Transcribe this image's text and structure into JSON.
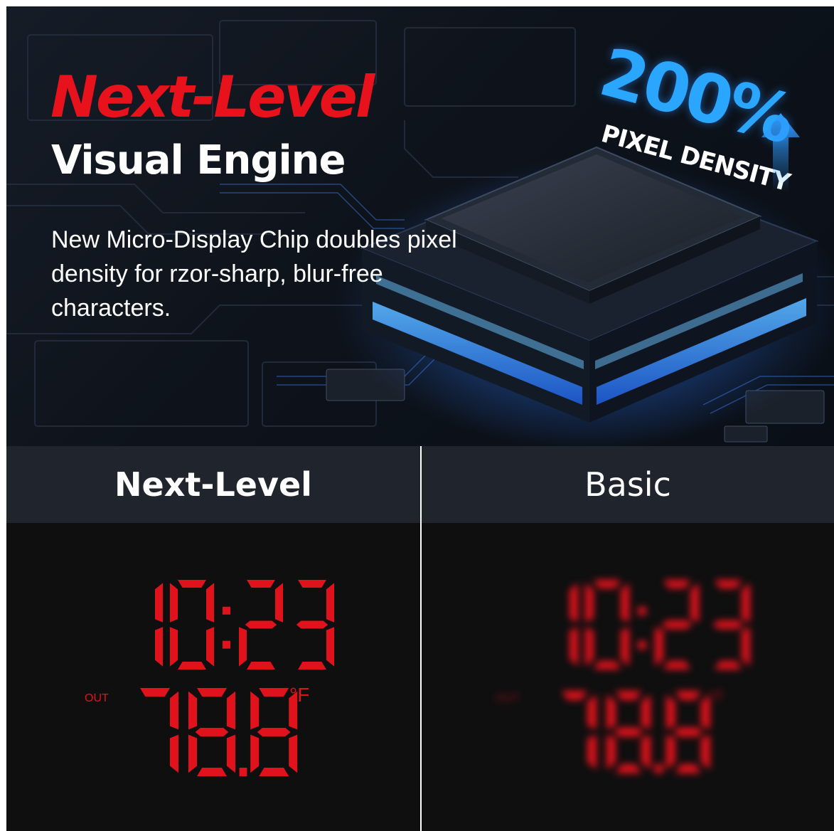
{
  "hero": {
    "headline": "Next-Level",
    "subheadline": "Visual Engine",
    "description": "New Micro-Display Chip doubles pixel density for rzor-sharp, blur-free characters.",
    "badge": {
      "percent": "200%",
      "label": "PIXEL DENSITY",
      "icon": "up-arrow-icon"
    }
  },
  "comparison": {
    "left": {
      "title": "Next-Level",
      "display": {
        "time": "10:23",
        "temperature": "78.8",
        "unit": "°F",
        "indicator": "OUT"
      }
    },
    "right": {
      "title": "Basic",
      "display": {
        "time": "10:23",
        "temperature": "78.8",
        "unit": "°F",
        "indicator": "OUT"
      }
    }
  },
  "colors": {
    "headline_red": "#e8121d",
    "display_red": "#e0121c",
    "accent_blue": "#2aa6ff",
    "panel_header": "#20242c"
  }
}
